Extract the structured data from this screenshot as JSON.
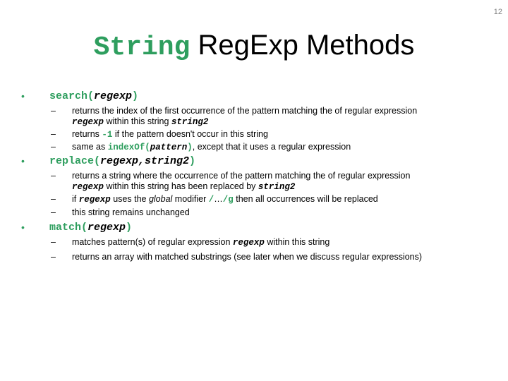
{
  "slide": {
    "page_number": "12",
    "title": {
      "code": "String",
      "text": "RegExp Methods"
    },
    "colors": {
      "accent_green": "#2e9e5e"
    },
    "bullet_glyph": "•",
    "dash_glyph": "–",
    "bullets": [
      {
        "method": "search(",
        "arg": "regexp",
        "close": ")",
        "subs": [
          {
            "line1": "returns the index of the first occurrence of the pattern matching the of regular expression",
            "line2_code": "regexp",
            "line2_text": " within this string ",
            "line2_code2": "string2"
          },
          {
            "pre": "returns ",
            "code": "-1",
            "post": " if the pattern doesn't occur in this string"
          },
          {
            "pre": "same as ",
            "code": "indexOf(",
            "arg": "pattern",
            "close": ")",
            "post": ", except that it uses a regular expression"
          }
        ]
      },
      {
        "method": "replace(",
        "arg": "regexp,string2",
        "close": ")",
        "subs": [
          {
            "line1": "returns a string where the occurrence of the pattern matching the of regular expression",
            "line2_code": "regexp",
            "line2_text": " within this string has been replaced by ",
            "line2_code2": "string2"
          },
          {
            "pre": "if ",
            "code": "regexp",
            "mid": " uses the ",
            "italic": "global",
            "mid2": " modifier ",
            "slash": "/",
            "dots": "…",
            "slashg": "/g",
            "post": " then all occurrences will be replaced"
          },
          {
            "text": "this string remains unchanged"
          }
        ]
      },
      {
        "method": "match(",
        "arg": "regexp",
        "close": ")",
        "subs": [
          {
            "pre": "matches pattern(s) of regular expression ",
            "code": "regexp",
            "post": " within this string"
          },
          {
            "text": "returns an array with matched substrings (see later when we discuss regular expressions)"
          }
        ]
      }
    ]
  }
}
